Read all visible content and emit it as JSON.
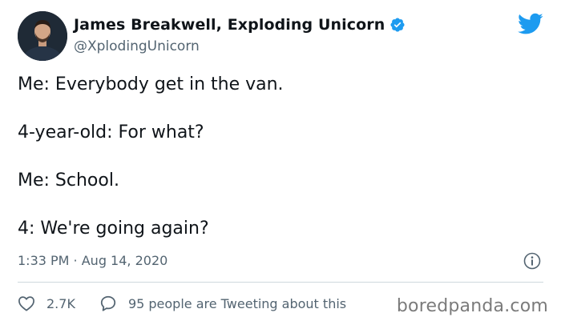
{
  "author": {
    "display_name": "James Breakwell, Exploding Unicorn",
    "handle": "@XplodingUnicorn",
    "avatar_icon": "person-avatar",
    "verified_icon": "verified-badge-icon"
  },
  "platform_icon": "twitter-bird-icon",
  "tweet": {
    "lines": [
      "Me: Everybody get in the van.",
      "4-year-old: For what?",
      "Me: School.",
      "4: We're going again?"
    ],
    "timestamp": "1:33 PM · Aug 14, 2020"
  },
  "actions": {
    "like_count": "2.7K",
    "conversation_text": "95 people are Tweeting about this"
  },
  "watermark": "boredpanda.com",
  "colors": {
    "twitter_blue": "#1d9bf0",
    "secondary_text": "#536471",
    "primary_text": "#0f1419",
    "divider": "#cfd9de"
  }
}
